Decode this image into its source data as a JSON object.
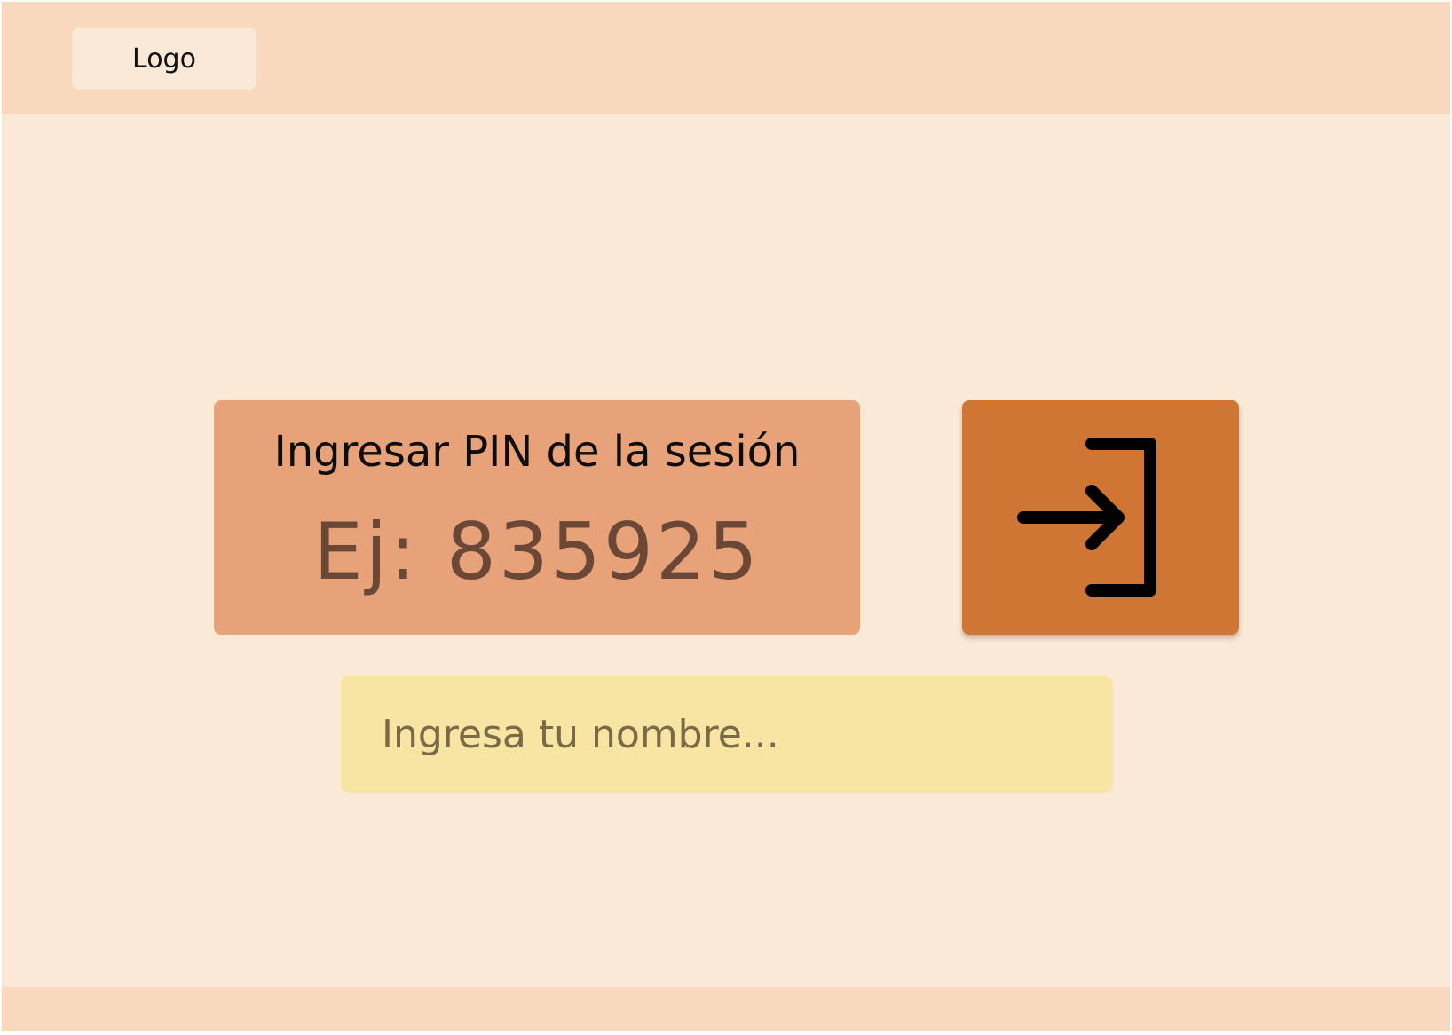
{
  "header": {
    "logo_label": "Logo"
  },
  "pin_card": {
    "label": "Ingresar PIN de la sesión",
    "placeholder": "Ej: 835925",
    "value": ""
  },
  "submit": {
    "icon": "log-in-icon"
  },
  "name_field": {
    "placeholder": "Ingresa tu nombre...",
    "value": ""
  },
  "colors": {
    "page_background": "#fbe9d8",
    "header_background": "#f9d9bd",
    "pin_card_background": "#e8a27a",
    "button_background": "#d07634",
    "name_field_background": "#f8e4a3"
  }
}
